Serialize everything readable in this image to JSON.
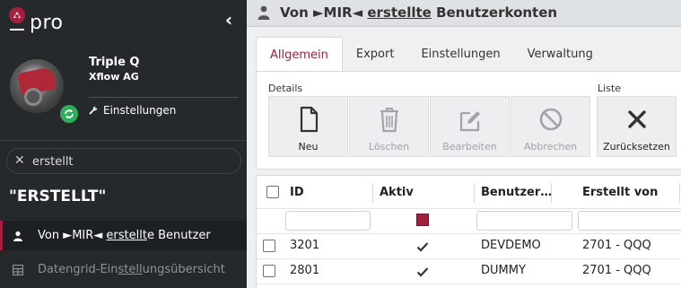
{
  "app": {
    "logo_text": "pro"
  },
  "user": {
    "name": "Triple Q",
    "company": "Xflow AG",
    "settings_label": "Einstellungen"
  },
  "search": {
    "value": "erstellt"
  },
  "results": {
    "title": "\"ERSTELLT\"",
    "items": [
      {
        "pre": "Von ►MIR◄ ",
        "match": "erstellt",
        "post": "e Benutzer",
        "icon": "user-icon",
        "active": true
      },
      {
        "pre": "Datengrid-Ein",
        "match": "stell",
        "post": "ungsübersicht",
        "icon": "grid-icon",
        "active": false
      }
    ]
  },
  "page": {
    "title_pre": "Von ►MIR◄ ",
    "title_match": "erstellte",
    "title_post": " Benutzerkonten",
    "tabs": [
      {
        "label": "Allgemein",
        "active": true
      },
      {
        "label": "Export",
        "active": false
      },
      {
        "label": "Einstellungen",
        "active": false
      },
      {
        "label": "Verwaltung",
        "active": false
      }
    ]
  },
  "ribbon": {
    "groups": [
      {
        "label": "Details"
      },
      {
        "label": "Liste"
      }
    ],
    "buttons": [
      {
        "label": "Neu",
        "icon": "file-icon",
        "enabled": true
      },
      {
        "label": "Löschen",
        "icon": "trash-icon",
        "enabled": false
      },
      {
        "label": "Bearbeiten",
        "icon": "edit-icon",
        "enabled": false
      },
      {
        "label": "Abbrechen",
        "icon": "cancel-icon",
        "enabled": false
      },
      {
        "label": "Zurücksetzen",
        "icon": "close-icon",
        "enabled": true
      }
    ]
  },
  "grid": {
    "columns": [
      "ID",
      "Aktiv",
      "Benutzer…",
      "Erstellt von"
    ],
    "rows": [
      {
        "id": "3201",
        "aktiv": true,
        "benutzer": "DEVDEMO",
        "erstellt_von": "2701 - QQQ"
      },
      {
        "id": "2801",
        "aktiv": true,
        "benutzer": "DUMMY",
        "erstellt_von": "2701 - QQQ"
      }
    ]
  },
  "colors": {
    "accent": "#a3203f",
    "sidebar": "#25292b",
    "status": "#2eae58"
  }
}
